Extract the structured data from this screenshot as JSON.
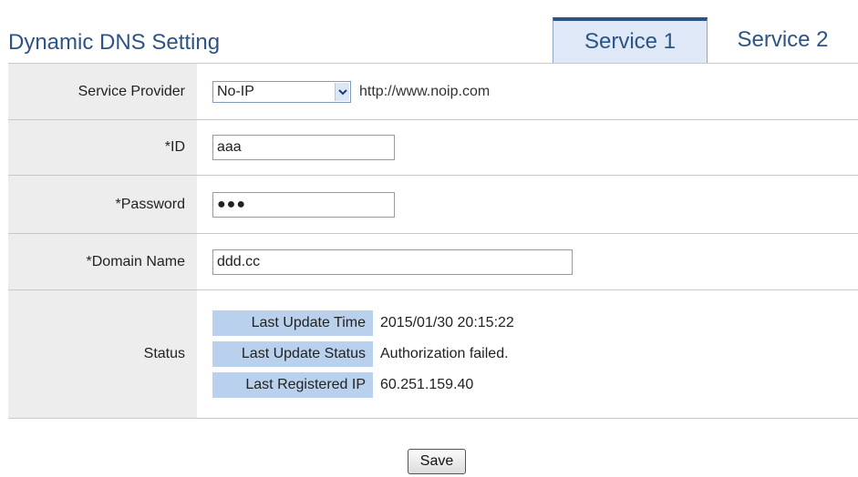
{
  "header": {
    "title": "Dynamic DNS Setting",
    "tabs": [
      {
        "label": "Service 1",
        "active": true
      },
      {
        "label": "Service 2",
        "active": false
      }
    ]
  },
  "form": {
    "service_provider": {
      "label": "Service Provider",
      "selected": "No-IP",
      "link": "http://www.noip.com"
    },
    "id": {
      "label": "*ID",
      "value": "aaa"
    },
    "password": {
      "label": "*Password",
      "masked_value": "●●●"
    },
    "domain_name": {
      "label": "*Domain Name",
      "value": "ddd.cc"
    },
    "status": {
      "label": "Status",
      "items": [
        {
          "key": "Last Update Time",
          "value": "2015/01/30 20:15:22"
        },
        {
          "key": "Last Update Status",
          "value": "Authorization failed."
        },
        {
          "key": "Last Registered IP",
          "value": "60.251.159.40"
        }
      ]
    }
  },
  "actions": {
    "save_label": "Save"
  },
  "colors": {
    "title": "#2d5486",
    "active_tab_bg": "#dfe8f6",
    "label_bg": "#ededed",
    "status_key_bg": "#b9d1ec"
  },
  "icons": {
    "select_arrow": "chevron-down-icon"
  }
}
